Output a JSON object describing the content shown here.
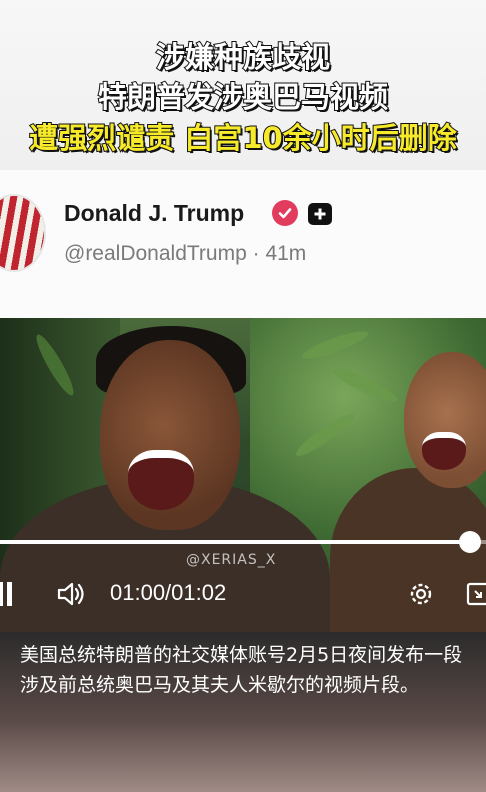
{
  "headline": {
    "line1": "涉嫌种族歧视",
    "line2": "特朗普发涉奥巴马视频",
    "line3": "遭强烈谴责 白宫10余小时后删除"
  },
  "post": {
    "user_name": "Donald J. Trump",
    "handle": "@realDonaldTrump",
    "separator": " · ",
    "time_ago": "41m"
  },
  "video": {
    "watermark": "@XERIAS_X",
    "time_display": "01:00/01:02",
    "progress_fraction": 0.968
  },
  "caption": {
    "text": "美国总统特朗普的社交媒体账号2月5日夜间发布一段涉及前总统奥巴马及其夫人米歇尔的视频片段。"
  },
  "colors": {
    "headline_highlight": "#f6ea2a",
    "verified_badge": "#e13b5e"
  }
}
